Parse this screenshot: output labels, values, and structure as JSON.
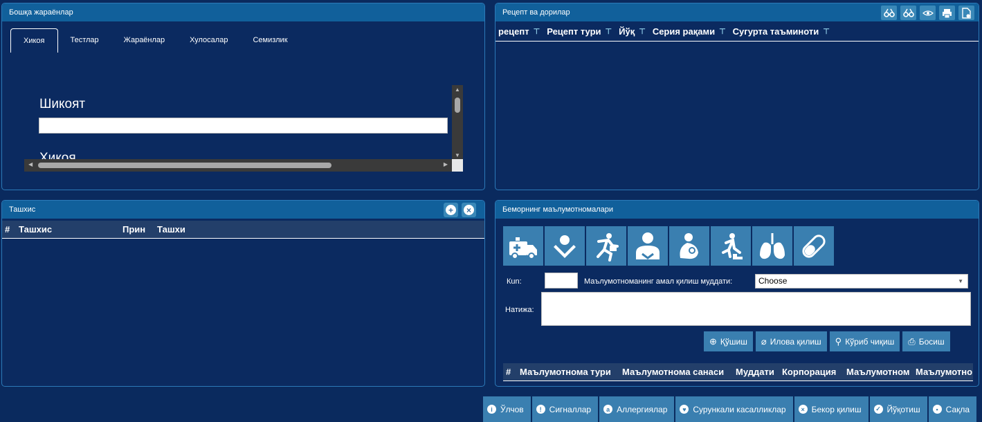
{
  "panel1": {
    "title": "Бошқа жараёнлар",
    "tabs": [
      "Хикоя",
      "Тестлар",
      "Жараёнлар",
      "Хулосалар",
      "Семизлик"
    ],
    "complaint_label": "Шикоят",
    "history_label": "Хикоя"
  },
  "panel2": {
    "title": "Рецепт ва дорилар",
    "columns": [
      "рецепт",
      "Рецепт тури",
      "Йўқ",
      "Серия рақами",
      "Сугурта таъминоти"
    ],
    "tools": [
      "glasses-add-icon",
      "glasses-remove-icon",
      "glasses-icon",
      "print-icon",
      "document-icon"
    ]
  },
  "panel3": {
    "title": "Ташхис",
    "columns": [
      "#",
      "Ташхис",
      "Прин",
      "Ташхи"
    ]
  },
  "panel4": {
    "title": "Беморнинг маълумотномалари",
    "icons": [
      "ambulance-icon",
      "mother-icon",
      "running-person-icon",
      "doctor-icon",
      "baby-icon",
      "falling-person-icon",
      "lungs-icon",
      "pill-icon"
    ],
    "day_label": "Кun:",
    "validity_label": "Маълумотноманинг амал қилиш муддати:",
    "validity_value": "Choose",
    "result_label": "Натижа:",
    "buttons": [
      "Қўшиш",
      "Илова қилиш",
      "Кўриб чиқиш",
      "Босиш"
    ],
    "columns": [
      "#",
      "Маълумотнома тури",
      "Маълумотнома санаси",
      "Муддати",
      "Корпорация",
      "Маълумотном",
      "Маълумотно"
    ]
  },
  "bottom_bar": [
    "Ўлчов",
    "Сигналлар",
    "Аллергиялар",
    "Сурункали касалликлар",
    "Бекор қилиш",
    "Йўқотиш",
    "Сақла"
  ]
}
